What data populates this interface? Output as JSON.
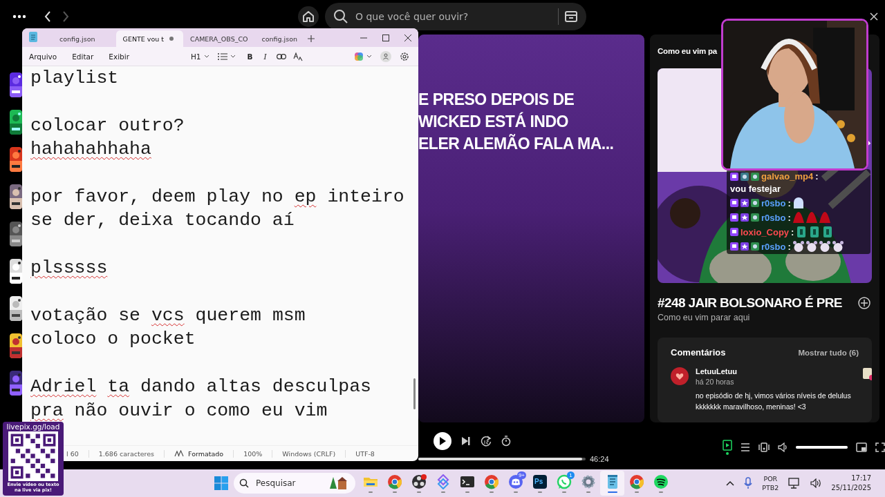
{
  "top_bar": {
    "search": {
      "placeholder": "O que você quer ouvir?"
    }
  },
  "episode_banner": {
    "lines": [
      "E PRESO DEPOIS DE",
      "WICKED ESTÁ INDO",
      "ELER ALEMÃO FALA MA..."
    ]
  },
  "side_panel": {
    "header": "Como eu vim pa",
    "chat": [
      {
        "user": "galvao_mp4",
        "color": "#f0a040",
        "separator": ":",
        "badges": [
          {
            "kind": "twitch"
          },
          {
            "kind": "gift"
          },
          {
            "kind": "sub"
          }
        ],
        "message": "vou festejar"
      },
      {
        "user": "r0sbo",
        "color": "#5aa0ff",
        "separator": ":",
        "badges": [
          {
            "kind": "twitch"
          },
          {
            "kind": "star"
          },
          {
            "kind": "sub"
          }
        ],
        "emotes": [
          {
            "kind": "ghost"
          }
        ]
      },
      {
        "user": "r0sbo",
        "color": "#5aa0ff",
        "separator": ":",
        "badges": [
          {
            "kind": "twitch"
          },
          {
            "kind": "star"
          },
          {
            "kind": "sub"
          }
        ],
        "emotes": [
          {
            "kind": "blob"
          },
          {
            "kind": "blob"
          },
          {
            "kind": "blob"
          }
        ]
      },
      {
        "user": "loxio_Copy",
        "color": "#ff4a50",
        "separator": ":",
        "badges": [
          {
            "kind": "twitch"
          }
        ],
        "emotes": [
          {
            "kind": "cup"
          },
          {
            "kind": "cup"
          },
          {
            "kind": "cup"
          }
        ]
      },
      {
        "user": "r0sbo",
        "color": "#5aa0ff",
        "separator": ":",
        "badges": [
          {
            "kind": "twitch"
          },
          {
            "kind": "star"
          },
          {
            "kind": "sub"
          }
        ],
        "emotes": [
          {
            "kind": "cat"
          },
          {
            "kind": "cat"
          },
          {
            "kind": "cat"
          },
          {
            "kind": "cat"
          }
        ]
      }
    ],
    "episode_title": "#248 JAIR BOLSONARO É PRE",
    "show_name": "Como eu vim parar aqui",
    "comments": {
      "title": "Comentários",
      "show_all": "Mostrar tudo (6)",
      "items": [
        {
          "author": "LetuuLetuu",
          "time": "há 20 horas",
          "text": "no episódio de hj, vimos vários níveis de delulus kkkkkkk maravilhoso, meninas! <3"
        }
      ]
    }
  },
  "player": {
    "time": "46:24",
    "progress": {
      "level": 0.98
    },
    "now_playing_view_on": true,
    "volume": {
      "level": 1
    }
  },
  "notepad": {
    "tabs": [
      {
        "label": "config.json",
        "selected": false,
        "modified": false
      },
      {
        "label": "GENTE vou t",
        "selected": true,
        "modified": true
      },
      {
        "label": "CAMERA_OBS_CO",
        "selected": false,
        "modified": false
      },
      {
        "label": "config.json",
        "selected": false,
        "modified": false
      }
    ],
    "menu": [
      "Arquivo",
      "Editar",
      "Exibir"
    ],
    "toolbar": {
      "heading": "H1",
      "bold": "B",
      "italic": "I"
    },
    "paragraphs": [
      {
        "lines": [
          [
            {
              "text": "playlist",
              "misspelled": false
            }
          ]
        ]
      },
      {
        "lines": [
          [
            {
              "text": "colocar outro?",
              "misspelled": false
            }
          ],
          [
            {
              "text": "hahahahhaha",
              "misspelled": true
            }
          ]
        ]
      },
      {
        "lines": [
          [
            {
              "text": "por favor, deem play no ",
              "misspelled": false
            },
            {
              "text": "ep",
              "misspelled": true
            },
            {
              "text": " inteiro",
              "misspelled": false
            }
          ],
          [
            {
              "text": "se der, deixa tocando aí",
              "misspelled": false
            }
          ]
        ]
      },
      {
        "lines": [
          [
            {
              "text": "plsssss",
              "misspelled": true
            }
          ]
        ]
      },
      {
        "lines": [
          [
            {
              "text": "votação se ",
              "misspelled": false
            },
            {
              "text": "vcs",
              "misspelled": true
            },
            {
              "text": " querem msm",
              "misspelled": false
            }
          ],
          [
            {
              "text": "coloco o pocket",
              "misspelled": false
            }
          ]
        ]
      },
      {
        "lines": [
          [
            {
              "text": "Adriel",
              "misspelled": true
            },
            {
              "text": " ta",
              "misspelled": true
            },
            {
              "text": " dando altas desculpas",
              "misspelled": false
            }
          ],
          [
            {
              "text": "pra",
              "misspelled": true
            },
            {
              "text": " não ouvir o como eu vim",
              "misspelled": false
            }
          ]
        ]
      }
    ],
    "status_bar": [
      {
        "kind": "text",
        "text": "l 60"
      },
      {
        "kind": "text",
        "text": "1.686 caracteres"
      },
      {
        "kind": "format",
        "text": "Formatado"
      },
      {
        "kind": "text",
        "text": "100%"
      },
      {
        "kind": "text",
        "text": "Windows (CRLF)"
      },
      {
        "kind": "text",
        "text": "UTF-8"
      }
    ]
  },
  "taskbar": {
    "search": {
      "placeholder": "Pesquisar"
    },
    "apps": [
      {
        "kind": "explorer",
        "active": false
      },
      {
        "kind": "chrome",
        "active": false
      },
      {
        "kind": "obs",
        "active": false
      },
      {
        "kind": "devtool",
        "active": false
      },
      {
        "kind": "terminal",
        "active": false
      },
      {
        "kind": "chrome",
        "active": false
      },
      {
        "kind": "discord",
        "active": false,
        "badge": "9+"
      },
      {
        "kind": "photoshop",
        "active": false,
        "label": "Ps"
      },
      {
        "kind": "whatsapp",
        "active": false,
        "badge": "1"
      },
      {
        "kind": "settings",
        "active": false
      },
      {
        "kind": "notepad",
        "active": true
      },
      {
        "kind": "chrome",
        "active": false
      },
      {
        "kind": "spotify",
        "active": false
      }
    ],
    "language": [
      "POR",
      "PTB2"
    ],
    "time": "17:17",
    "date": "25/11/2025"
  },
  "livepix": {
    "url": "livepix.gg/load",
    "caption": "Envie vídeo ou texto na live via pix!"
  }
}
